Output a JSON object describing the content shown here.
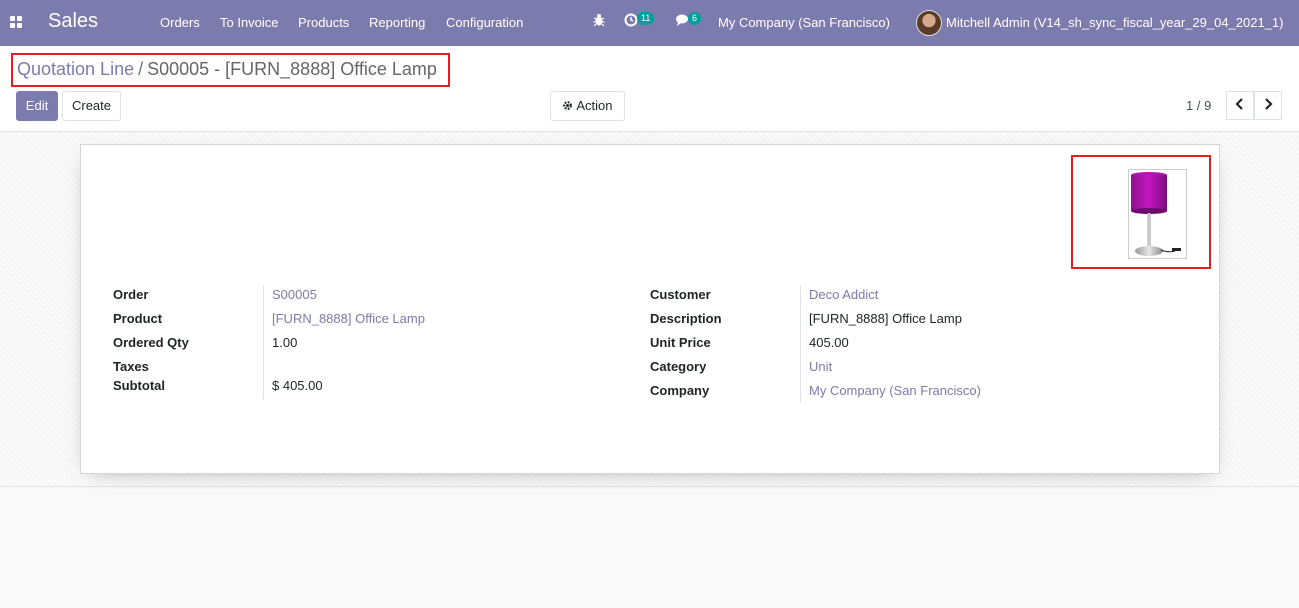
{
  "navbar": {
    "app_name": "Sales",
    "menu": [
      "Orders",
      "To Invoice",
      "Products",
      "Reporting",
      "Configuration"
    ],
    "activity_count": "11",
    "messages_count": "6",
    "company": "My Company (San Francisco)",
    "user": "Mitchell Admin (V14_sh_sync_fiscal_year_29_04_2021_1)",
    "colors": {
      "primary": "#7c7bad",
      "badge": "#00a09d"
    }
  },
  "breadcrumb": {
    "parent": "Quotation Line",
    "separator": "/",
    "current": "S00005 - [FURN_8888] Office Lamp"
  },
  "toolbar": {
    "edit_label": "Edit",
    "create_label": "Create",
    "action_label": "Action"
  },
  "pager": {
    "value": "1 / 9",
    "prev": "‹",
    "next": "›"
  },
  "form": {
    "left": [
      {
        "label": "Order",
        "value": "S00005",
        "link": true
      },
      {
        "label": "Product",
        "value": "[FURN_8888] Office Lamp",
        "link": true
      },
      {
        "label": "Ordered Qty",
        "value": "1.00",
        "link": false
      },
      {
        "label": "Taxes",
        "value": "",
        "link": false
      },
      {
        "label": "Subtotal",
        "value": "$ 405.00",
        "link": false
      }
    ],
    "right": [
      {
        "label": "Customer",
        "value": "Deco Addict",
        "link": true
      },
      {
        "label": "Description",
        "value": "[FURN_8888] Office Lamp",
        "link": false
      },
      {
        "label": "Unit Price",
        "value": "405.00",
        "link": false
      },
      {
        "label": "Category",
        "value": "Unit",
        "link": true
      },
      {
        "label": "Company",
        "value": "My Company (San Francisco)",
        "link": true
      }
    ]
  }
}
